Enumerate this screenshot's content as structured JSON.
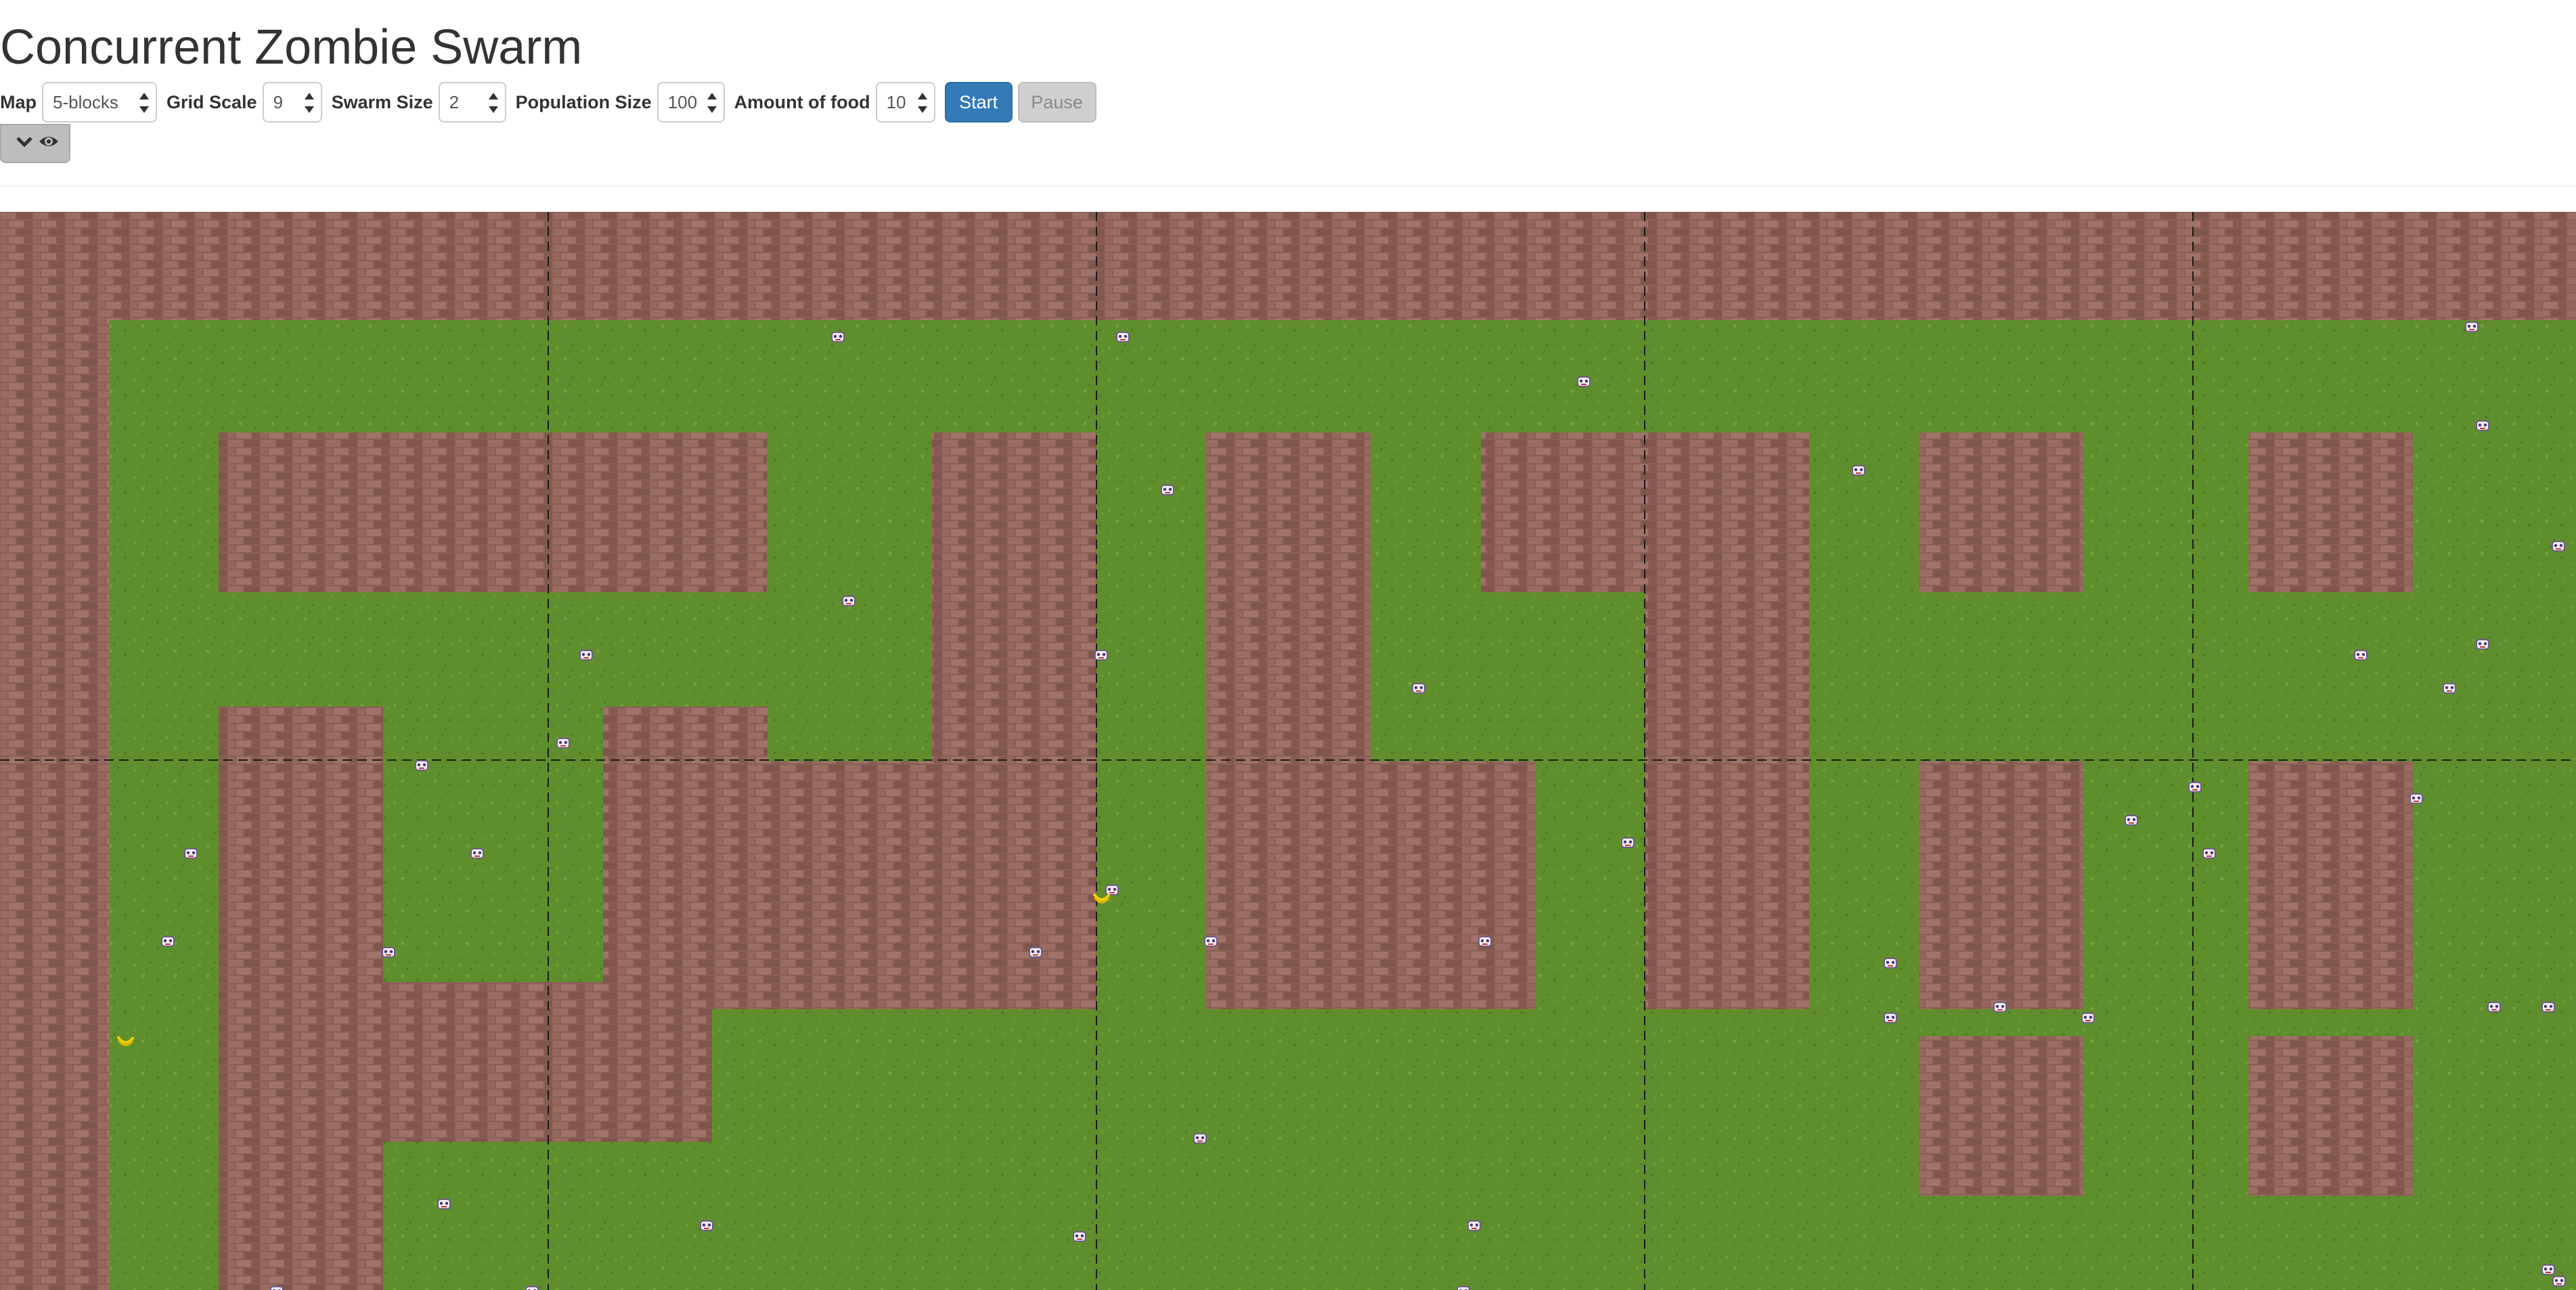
{
  "page": {
    "title": "Concurrent Zombie Swarm"
  },
  "controls": {
    "map": {
      "label": "Map",
      "value": "5-blocks"
    },
    "grid_scale": {
      "label": "Grid Scale",
      "value": "9"
    },
    "swarm_size": {
      "label": "Swarm Size",
      "value": "2"
    },
    "population_size": {
      "label": "Population Size",
      "value": "100"
    },
    "food_amount": {
      "label": "Amount of food",
      "value": "10"
    },
    "start_label": "Start",
    "pause_label": "Pause",
    "pause_disabled": true
  },
  "view_toggle": {
    "icons": [
      "chevron-down-icon",
      "eye-icon"
    ]
  },
  "game": {
    "map_name": "5-blocks",
    "colors": {
      "grass": "#5f8f2c",
      "wall": "#8a5e55",
      "start_button": "#337ab7",
      "pause_button": "#cfcfcf"
    },
    "visible_counts": {
      "zombies": 46,
      "bananas": 2
    }
  }
}
